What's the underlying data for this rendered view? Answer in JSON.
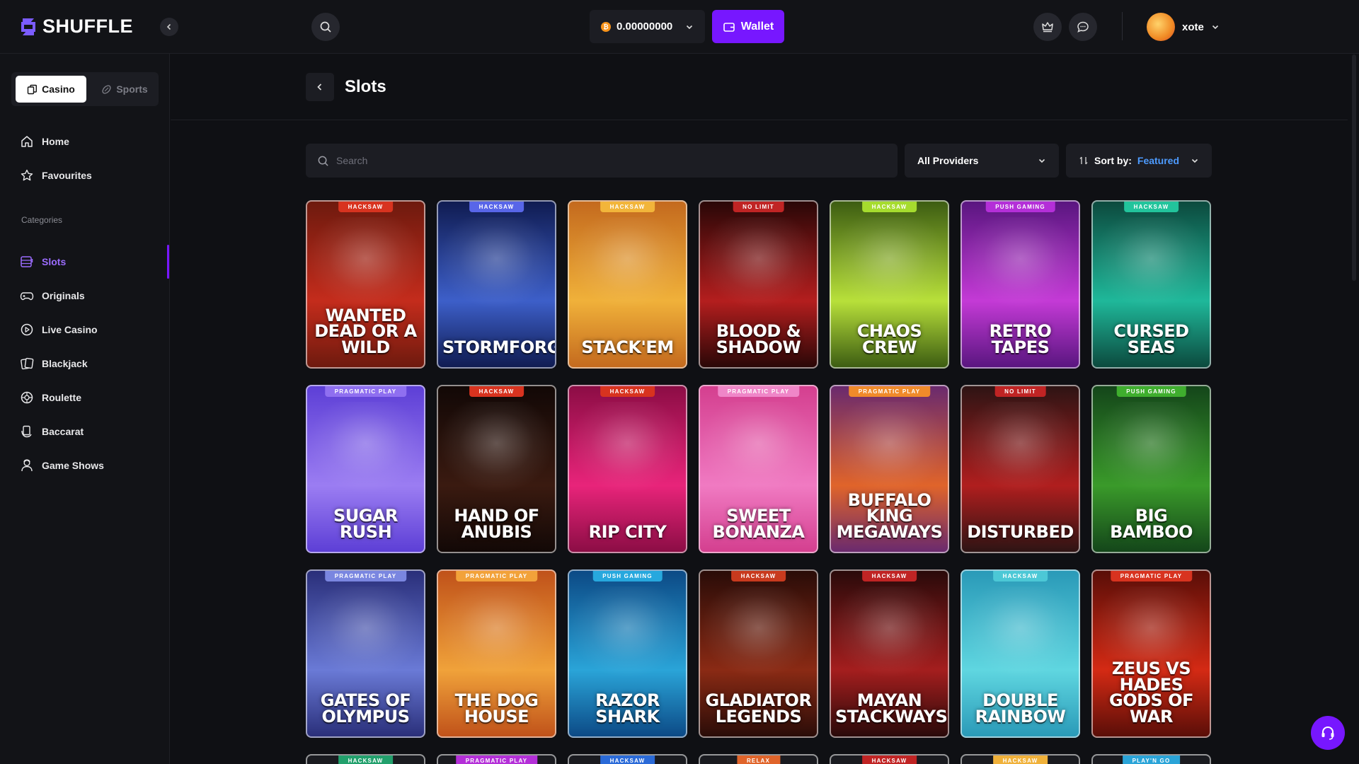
{
  "brand": {
    "name": "SHUFFLE"
  },
  "header": {
    "balance": "0.00000000",
    "currency_icon": "bitcoin-icon",
    "wallet_label": "Wallet",
    "username": "xote"
  },
  "sidebar": {
    "casino_label": "Casino",
    "sports_label": "Sports",
    "top_items": [
      {
        "label": "Home",
        "icon": "home-icon"
      },
      {
        "label": "Favourites",
        "icon": "star-icon"
      }
    ],
    "categories_label": "Categories",
    "items": [
      {
        "label": "Slots",
        "icon": "slots-icon",
        "active": true
      },
      {
        "label": "Originals",
        "icon": "gamepad-icon"
      },
      {
        "label": "Live Casino",
        "icon": "play-circle-icon"
      },
      {
        "label": "Blackjack",
        "icon": "cards-icon"
      },
      {
        "label": "Roulette",
        "icon": "roulette-icon"
      },
      {
        "label": "Baccarat",
        "icon": "baccarat-icon"
      },
      {
        "label": "Game Shows",
        "icon": "presenter-icon"
      }
    ]
  },
  "page": {
    "title": "Slots",
    "search_placeholder": "Search",
    "providers_label": "All Providers",
    "sort_prefix": "Sort by:",
    "sort_value": "Featured"
  },
  "games": [
    {
      "provider": "HACKSAW",
      "title": "Wanted Dead or a Wild",
      "bg": "#c42c1c",
      "bg2": "#6e1a0e",
      "tag": "#d8331f"
    },
    {
      "provider": "HACKSAW",
      "title": "Stormforged",
      "bg": "#3d5fc9",
      "bg2": "#101c52",
      "tag": "#5866e8"
    },
    {
      "provider": "HACKSAW",
      "title": "Stack'Em",
      "bg": "#f0b13a",
      "bg2": "#c46a1e",
      "tag": "#f2b53a"
    },
    {
      "provider": "NO LIMIT",
      "title": "Blood & Shadow",
      "bg": "#b41e1e",
      "bg2": "#2a0707",
      "tag": "#c02424"
    },
    {
      "provider": "HACKSAW",
      "title": "Chaos Crew",
      "bg": "#b8e03a",
      "bg2": "#3d5d12",
      "tag": "#a6dc2e"
    },
    {
      "provider": "PUSH GAMING",
      "title": "Retro Tapes",
      "bg": "#c43ad6",
      "bg2": "#5a1680",
      "tag": "#b42fd8"
    },
    {
      "provider": "HACKSAW",
      "title": "Cursed Seas",
      "bg": "#1fb89a",
      "bg2": "#0c4a3e",
      "tag": "#22c49c"
    },
    {
      "provider": "PRAGMATIC PLAY",
      "title": "Sugar Rush",
      "bg": "#9b7df2",
      "bg2": "#5d3fd6",
      "tag": "#8f6ff0"
    },
    {
      "provider": "HACKSAW",
      "title": "Hand of Anubis",
      "bg": "#3a1a10",
      "bg2": "#120806",
      "tag": "#d8331f"
    },
    {
      "provider": "HACKSAW",
      "title": "Rip City",
      "bg": "#e8247a",
      "bg2": "#8c0d45",
      "tag": "#d8331f"
    },
    {
      "provider": "PRAGMATIC PLAY",
      "title": "Sweet Bonanza",
      "bg": "#f07ac2",
      "bg2": "#d43f8f",
      "tag": "#ef86c8"
    },
    {
      "provider": "PRAGMATIC PLAY",
      "title": "Buffalo King Megaways",
      "bg": "#e0642a",
      "bg2": "#6a2a6e",
      "tag": "#f08a2a"
    },
    {
      "provider": "NO LIMIT",
      "title": "Disturbed",
      "bg": "#b01e1e",
      "bg2": "#2e1414",
      "tag": "#c02424"
    },
    {
      "provider": "PUSH GAMING",
      "title": "Big Bamboo",
      "bg": "#3a9a2a",
      "bg2": "#14461a",
      "tag": "#3fae2e"
    },
    {
      "provider": "PRAGMATIC PLAY",
      "title": "Gates of Olympus",
      "bg": "#6a7ad6",
      "bg2": "#2a2f7a",
      "tag": "#7a86e0"
    },
    {
      "provider": "PRAGMATIC PLAY",
      "title": "The Dog House",
      "bg": "#f0a23a",
      "bg2": "#c0521a",
      "tag": "#f2a23a"
    },
    {
      "provider": "PUSH GAMING",
      "title": "Razor Shark",
      "bg": "#2aa4d8",
      "bg2": "#0c4a86",
      "tag": "#27a8de"
    },
    {
      "provider": "HACKSAW",
      "title": "Gladiator Legends",
      "bg": "#8a2a14",
      "bg2": "#2a0c08",
      "tag": "#c83a1e"
    },
    {
      "provider": "HACKSAW",
      "title": "Mayan Stackways",
      "bg": "#a41e1e",
      "bg2": "#2a0a0a",
      "tag": "#c02424"
    },
    {
      "provider": "HACKSAW",
      "title": "Double Rainbow",
      "bg": "#5fd6e0",
      "bg2": "#2a9ab8",
      "tag": "#4cc8d6"
    },
    {
      "provider": "PRAGMATIC PLAY",
      "title": "Zeus vs Hades Gods of War",
      "bg": "#d42a14",
      "bg2": "#5a0e08",
      "tag": "#d8331f"
    }
  ],
  "peek_games": [
    {
      "provider": "HACKSAW",
      "tag": "#22a06c"
    },
    {
      "provider": "PRAGMATIC PLAY",
      "tag": "#b42fd8"
    },
    {
      "provider": "HACKSAW",
      "tag": "#2a6ad8"
    },
    {
      "provider": "RELAX",
      "tag": "#e0642a"
    },
    {
      "provider": "HACKSAW",
      "tag": "#c02424"
    },
    {
      "provider": "HACKSAW",
      "tag": "#f0b13a"
    },
    {
      "provider": "PLAY'N GO",
      "tag": "#2aa4d8"
    }
  ]
}
